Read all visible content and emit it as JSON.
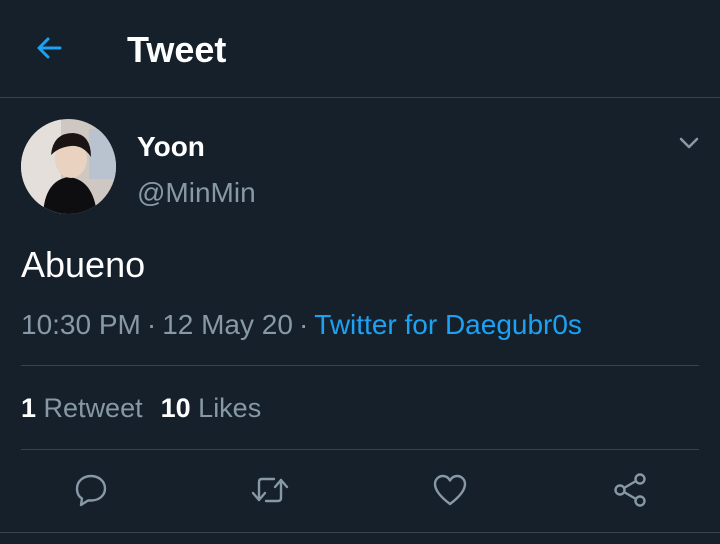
{
  "header": {
    "title": "Tweet"
  },
  "author": {
    "name": "Yoon",
    "handle": "@MinMin"
  },
  "tweet": {
    "text": "Abueno",
    "time": "10:30 PM",
    "date": "12 May 20",
    "separator": "·",
    "source": "Twitter for Daegubr0s"
  },
  "stats": {
    "retweets_count": "1",
    "retweets_label": "Retweet",
    "likes_count": "10",
    "likes_label": "Likes"
  },
  "actions": [
    "reply-icon",
    "retweet-icon",
    "like-icon",
    "share-icon"
  ],
  "colors": {
    "background": "#15202b",
    "accent": "#1da1f2",
    "muted": "#8899a6",
    "divider": "#38444d"
  }
}
